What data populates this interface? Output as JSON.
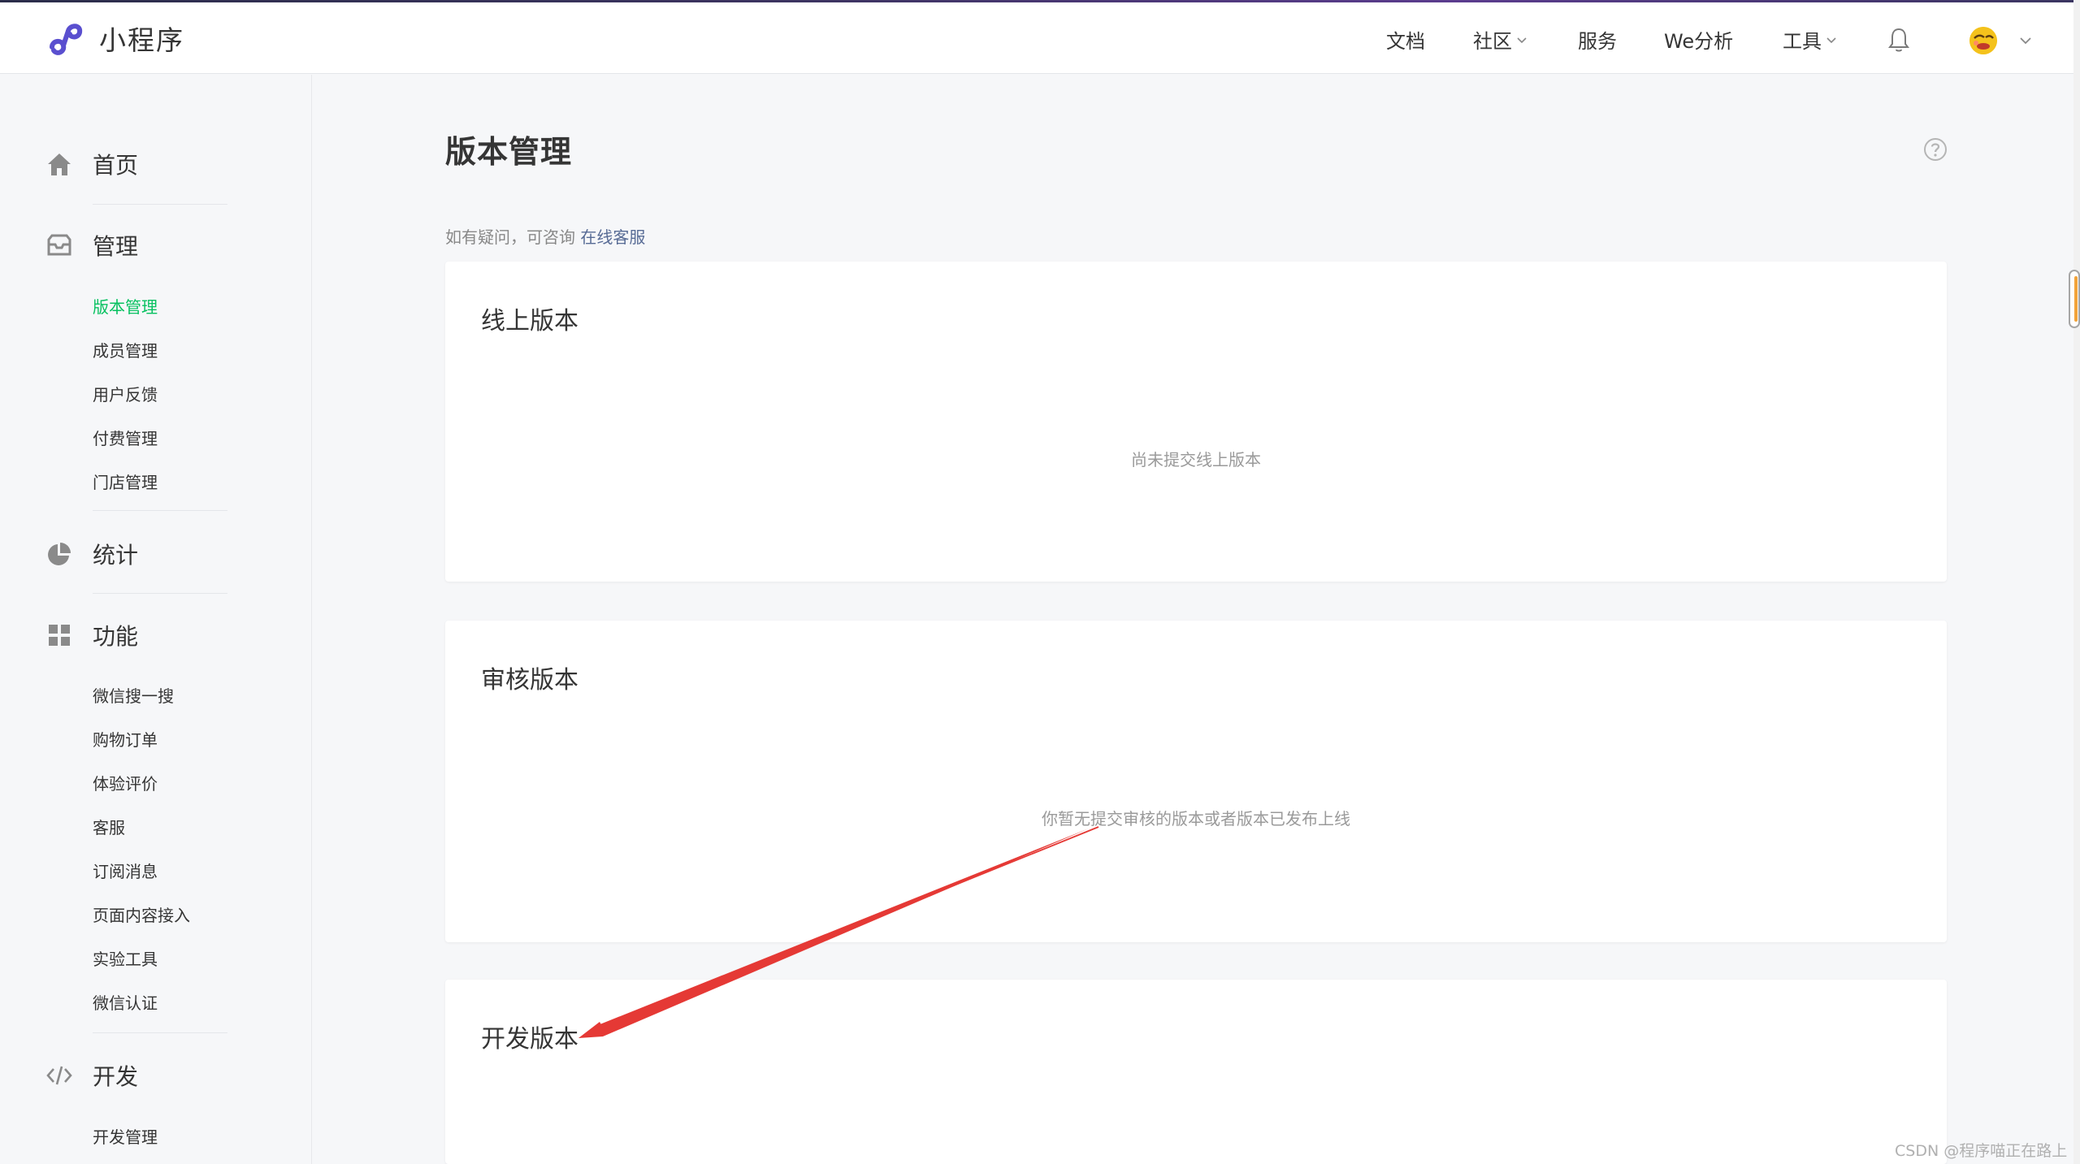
{
  "header": {
    "logo_text": "小程序",
    "nav": {
      "docs": "文档",
      "community": "社区",
      "services": "服务",
      "we_analysis": "We分析",
      "tools": "工具"
    }
  },
  "sidebar": {
    "home": "首页",
    "manage": {
      "label": "管理",
      "items": [
        "版本管理",
        "成员管理",
        "用户反馈",
        "付费管理",
        "门店管理"
      ]
    },
    "stats": "统计",
    "features": {
      "label": "功能",
      "items": [
        "微信搜一搜",
        "购物订单",
        "体验评价",
        "客服",
        "订阅消息",
        "页面内容接入",
        "实验工具",
        "微信认证"
      ]
    },
    "develop": {
      "label": "开发",
      "items": [
        "开发管理"
      ]
    }
  },
  "main": {
    "title": "版本管理",
    "tip_prefix": "如有疑问，可咨询",
    "tip_link": "在线客服",
    "online_card": {
      "title": "线上版本",
      "empty": "尚未提交线上版本"
    },
    "review_card": {
      "title": "审核版本",
      "empty": "你暂无提交审核的版本或者版本已发布上线"
    },
    "dev_card": {
      "title": "开发版本"
    }
  },
  "watermark": "CSDN @程序喵正在路上",
  "colors": {
    "active_menu": "#07c160",
    "link": "#576b95",
    "annotation_arrow": "#e53935",
    "logo": "#5a4fcf"
  }
}
